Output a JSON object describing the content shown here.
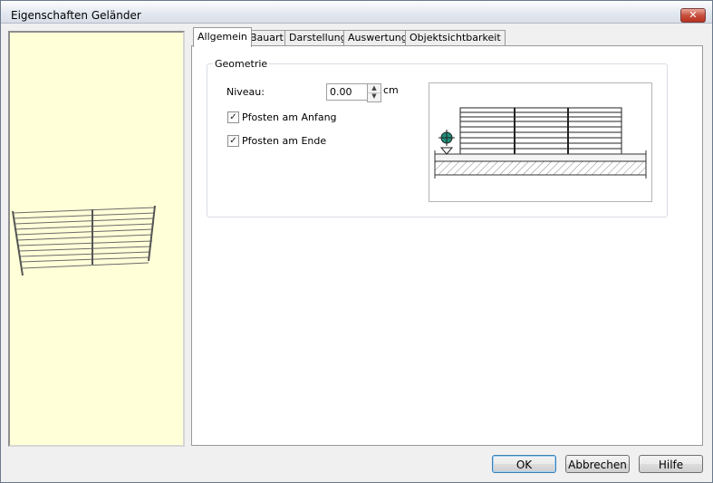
{
  "window": {
    "title": "Eigenschaften Geländer",
    "close_glyph": "✕"
  },
  "tabs": [
    {
      "label": "Allgemein",
      "active": true
    },
    {
      "label": "Bauart",
      "active": false
    },
    {
      "label": "Darstellung",
      "active": false
    },
    {
      "label": "Auswertung",
      "active": false
    },
    {
      "label": "Objektsichtbarkeit",
      "active": false
    }
  ],
  "general": {
    "group_label": "Geometrie",
    "niveau_label": "Niveau:",
    "niveau_value": "0.00",
    "niveau_unit": "cm",
    "spin_up_glyph": "▲",
    "spin_down_glyph": "▼",
    "check_start_label": "Pfosten am Anfang",
    "check_start_checked": true,
    "check_end_label": "Pfosten am Ende",
    "check_end_checked": true,
    "check_glyph": "✓"
  },
  "buttons": {
    "ok": "OK",
    "cancel": "Abbrechen",
    "help": "Hilfe"
  },
  "colors": {
    "preview_bg": "#ffffd8",
    "marker": "#1f8f7a"
  }
}
